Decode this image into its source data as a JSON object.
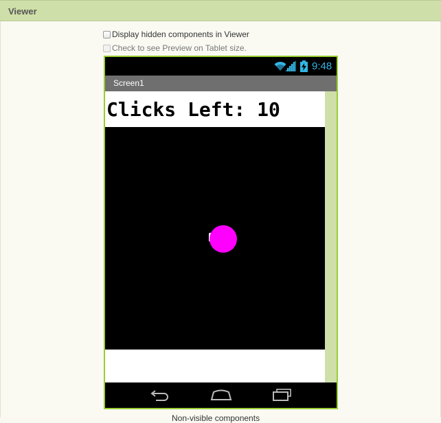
{
  "panel": {
    "title": "Viewer"
  },
  "options": {
    "display_hidden": "Display hidden components in Viewer",
    "tablet_preview": "Check to see Preview on Tablet size."
  },
  "phone": {
    "status": {
      "time": "9:48"
    },
    "screen_title": "Screen1",
    "label_text": "Clicks Left: 10",
    "ball_color": "#ff00ff",
    "status_icon_color": "#33b5e5",
    "canvas_color": "#000000"
  },
  "footer": {
    "nonvisible_text": "Non-visible components"
  }
}
